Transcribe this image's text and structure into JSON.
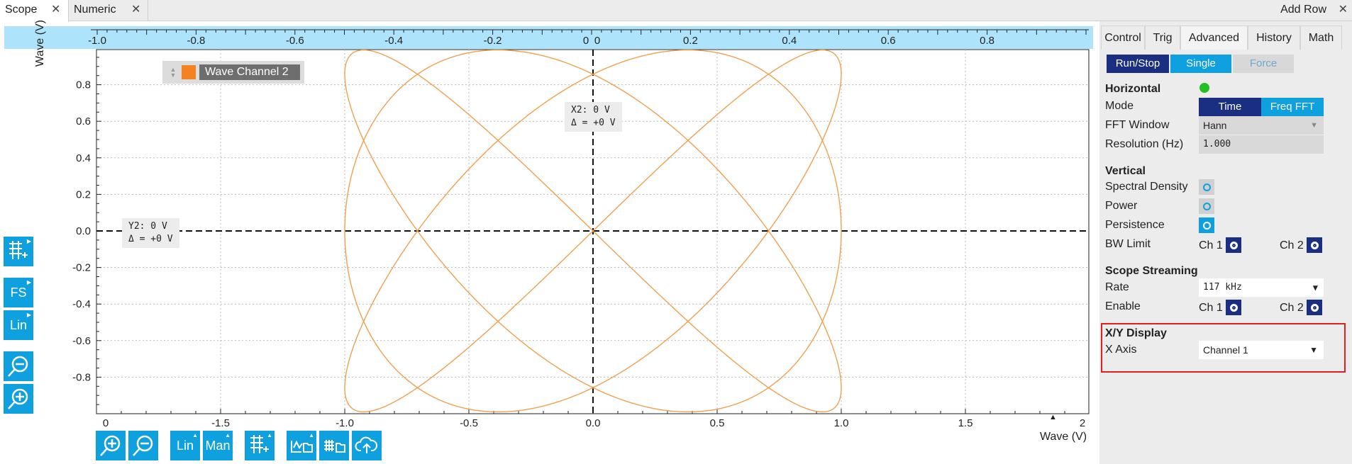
{
  "tabs": [
    {
      "label": "Scope",
      "active": true
    },
    {
      "label": "Numeric",
      "active": false
    }
  ],
  "add_row": "Add Row",
  "close_glyph": "✕",
  "plot": {
    "ylabel": "Wave (V)",
    "xlabel": "Wave (V)",
    "y_ticks": [
      "0.8",
      "0.6",
      "0.4",
      "0.2",
      "0.0",
      "-0.2",
      "-0.4",
      "-0.6",
      "-0.8"
    ],
    "x_ticks_bottom": [
      "0",
      "-1.5",
      "-1.0",
      "-0.5",
      "0.0",
      "0.5",
      "1.0",
      "1.5",
      "2"
    ],
    "x_ticks_top": [
      "-1.0",
      "-0.8",
      "-0.6",
      "-0.4",
      "-0.2",
      "0",
      "0",
      "0.2",
      "0.4",
      "0.6",
      "0.8"
    ],
    "legend": "Wave Channel 2",
    "legend_color": "#f58220",
    "cursor_x": {
      "line1": "X2: 0 V",
      "line2": "Δ = +0 V"
    },
    "cursor_y": {
      "line1": "Y2: 0 V",
      "line2": "Δ = +0 V"
    },
    "trace_color": "#f0a050"
  },
  "left_tools": [
    {
      "icon": "grid-cursor-icon"
    },
    {
      "label": "FS"
    },
    {
      "label": "Lin"
    },
    {
      "icon": "zoom-out-icon"
    },
    {
      "icon": "zoom-in-icon"
    }
  ],
  "bottom_tools": [
    {
      "icon": "zoom-in-icon"
    },
    {
      "icon": "zoom-out-icon"
    },
    {
      "label": "Lin"
    },
    {
      "label": "Man"
    },
    {
      "icon": "grid-cursor-icon"
    },
    {
      "icon": "waveform-folder-icon"
    },
    {
      "icon": "data-folder-icon"
    },
    {
      "icon": "cloud-upload-icon"
    }
  ],
  "panel": {
    "tabs": [
      "Control",
      "Trig",
      "Advanced",
      "History",
      "Math"
    ],
    "active_tab": "Advanced",
    "run_stop": "Run/Stop",
    "single": "Single",
    "force": "Force",
    "horizontal": "Horizontal",
    "mode": "Mode",
    "mode_time": "Time",
    "mode_fft": "Freq FFT",
    "fft_window": "FFT Window",
    "fft_window_value": "Hann",
    "resolution": "Resolution (Hz)",
    "resolution_value": "1.000",
    "vertical": "Vertical",
    "spectral_density": "Spectral Density",
    "power": "Power",
    "persistence": "Persistence",
    "bw_limit": "BW Limit",
    "ch1": "Ch 1",
    "ch2": "Ch 2",
    "scope_streaming": "Scope Streaming",
    "rate": "Rate",
    "rate_value": "117 kHz",
    "enable": "Enable",
    "xy_display": "X/Y Display",
    "x_axis": "X Axis",
    "x_axis_value": "Channel 1"
  },
  "colors": {
    "accent": "#0fa0e0",
    "dark_accent": "#1a2f82",
    "highlight_box": "#e02020",
    "status_led": "#22c022"
  }
}
